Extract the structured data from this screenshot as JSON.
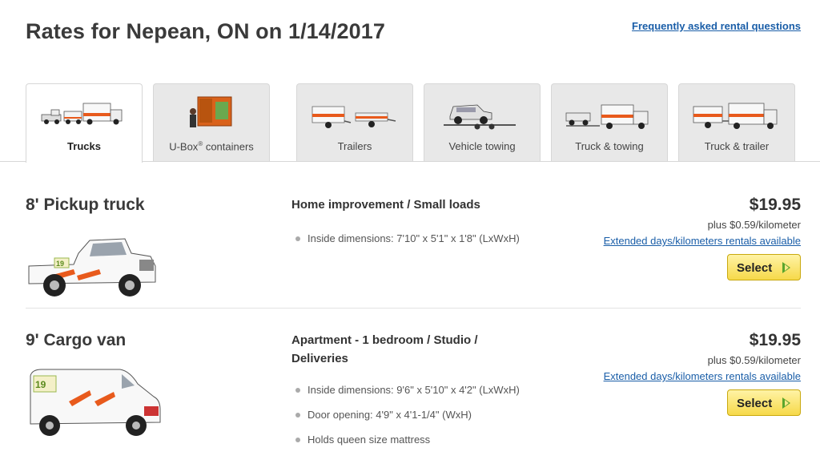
{
  "header": {
    "title": "Rates for Nepean, ON on 1/14/2017",
    "faq_link": "Frequently asked rental questions"
  },
  "tabs": [
    {
      "label": "Trucks",
      "icon": "trucks-icon",
      "active": true
    },
    {
      "label": "U-Box",
      "label_sup": "®",
      "label_suffix": " containers",
      "icon": "ubox-container-icon",
      "active": false
    },
    {
      "label": "Trailers",
      "icon": "trailers-icon",
      "active": false
    },
    {
      "label": "Vehicle towing",
      "icon": "vehicle-towing-icon",
      "active": false
    },
    {
      "label": "Truck & towing",
      "icon": "truck-towing-icon",
      "active": false
    },
    {
      "label": "Truck & trailer",
      "icon": "truck-trailer-icon",
      "active": false
    }
  ],
  "vehicles": [
    {
      "name": "8' Pickup truck",
      "usage": "Home improvement / Small loads",
      "specs": [
        "Inside dimensions: 7'10\" x 5'1\" x 1'8\" (LxWxH)"
      ],
      "price": "$19.95",
      "rate": "plus $0.59/kilometer",
      "extended_link": "Extended days/kilometers rentals available",
      "select_label": "Select",
      "image": "pickup-truck-image"
    },
    {
      "name": "9' Cargo van",
      "usage": "Apartment - 1 bedroom / Studio / Deliveries",
      "specs": [
        "Inside dimensions: 9'6\" x 5'10\" x 4'2\" (LxWxH)",
        "Door opening: 4'9\" x 4'1-1/4\" (WxH)",
        "Holds queen size mattress"
      ],
      "price": "$19.95",
      "rate": "plus $0.59/kilometer",
      "extended_link": "Extended days/kilometers rentals available",
      "select_label": "Select",
      "image": "cargo-van-image"
    }
  ],
  "colors": {
    "link": "#1a5ea8",
    "brand_orange": "#e85a1c",
    "select_button": "#f6d94a",
    "select_arrow": "#5aa52c"
  }
}
